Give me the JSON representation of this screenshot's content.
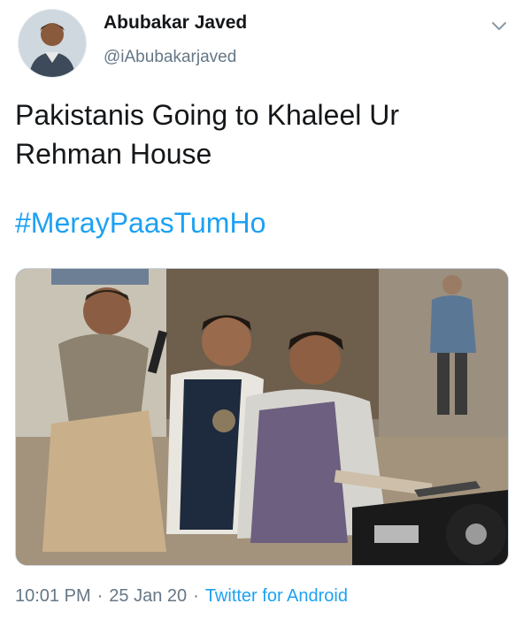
{
  "author": {
    "name": "Abubakar Javed",
    "handle": "@iAbubakarjaved",
    "avatar_icon": "profile-photo"
  },
  "tweet": {
    "text": "Pakistanis Going to Khaleel Ur Rehman House",
    "hashtag": "#MerayPaasTumHo"
  },
  "media": {
    "icon": "photo-three-men-on-motorcycle"
  },
  "meta": {
    "time": "10:01 PM",
    "date": "25 Jan 20",
    "source": "Twitter for Android",
    "separator": "·"
  },
  "colors": {
    "link": "#1da1f2",
    "secondary_text": "#657786",
    "primary_text": "#14171a"
  }
}
